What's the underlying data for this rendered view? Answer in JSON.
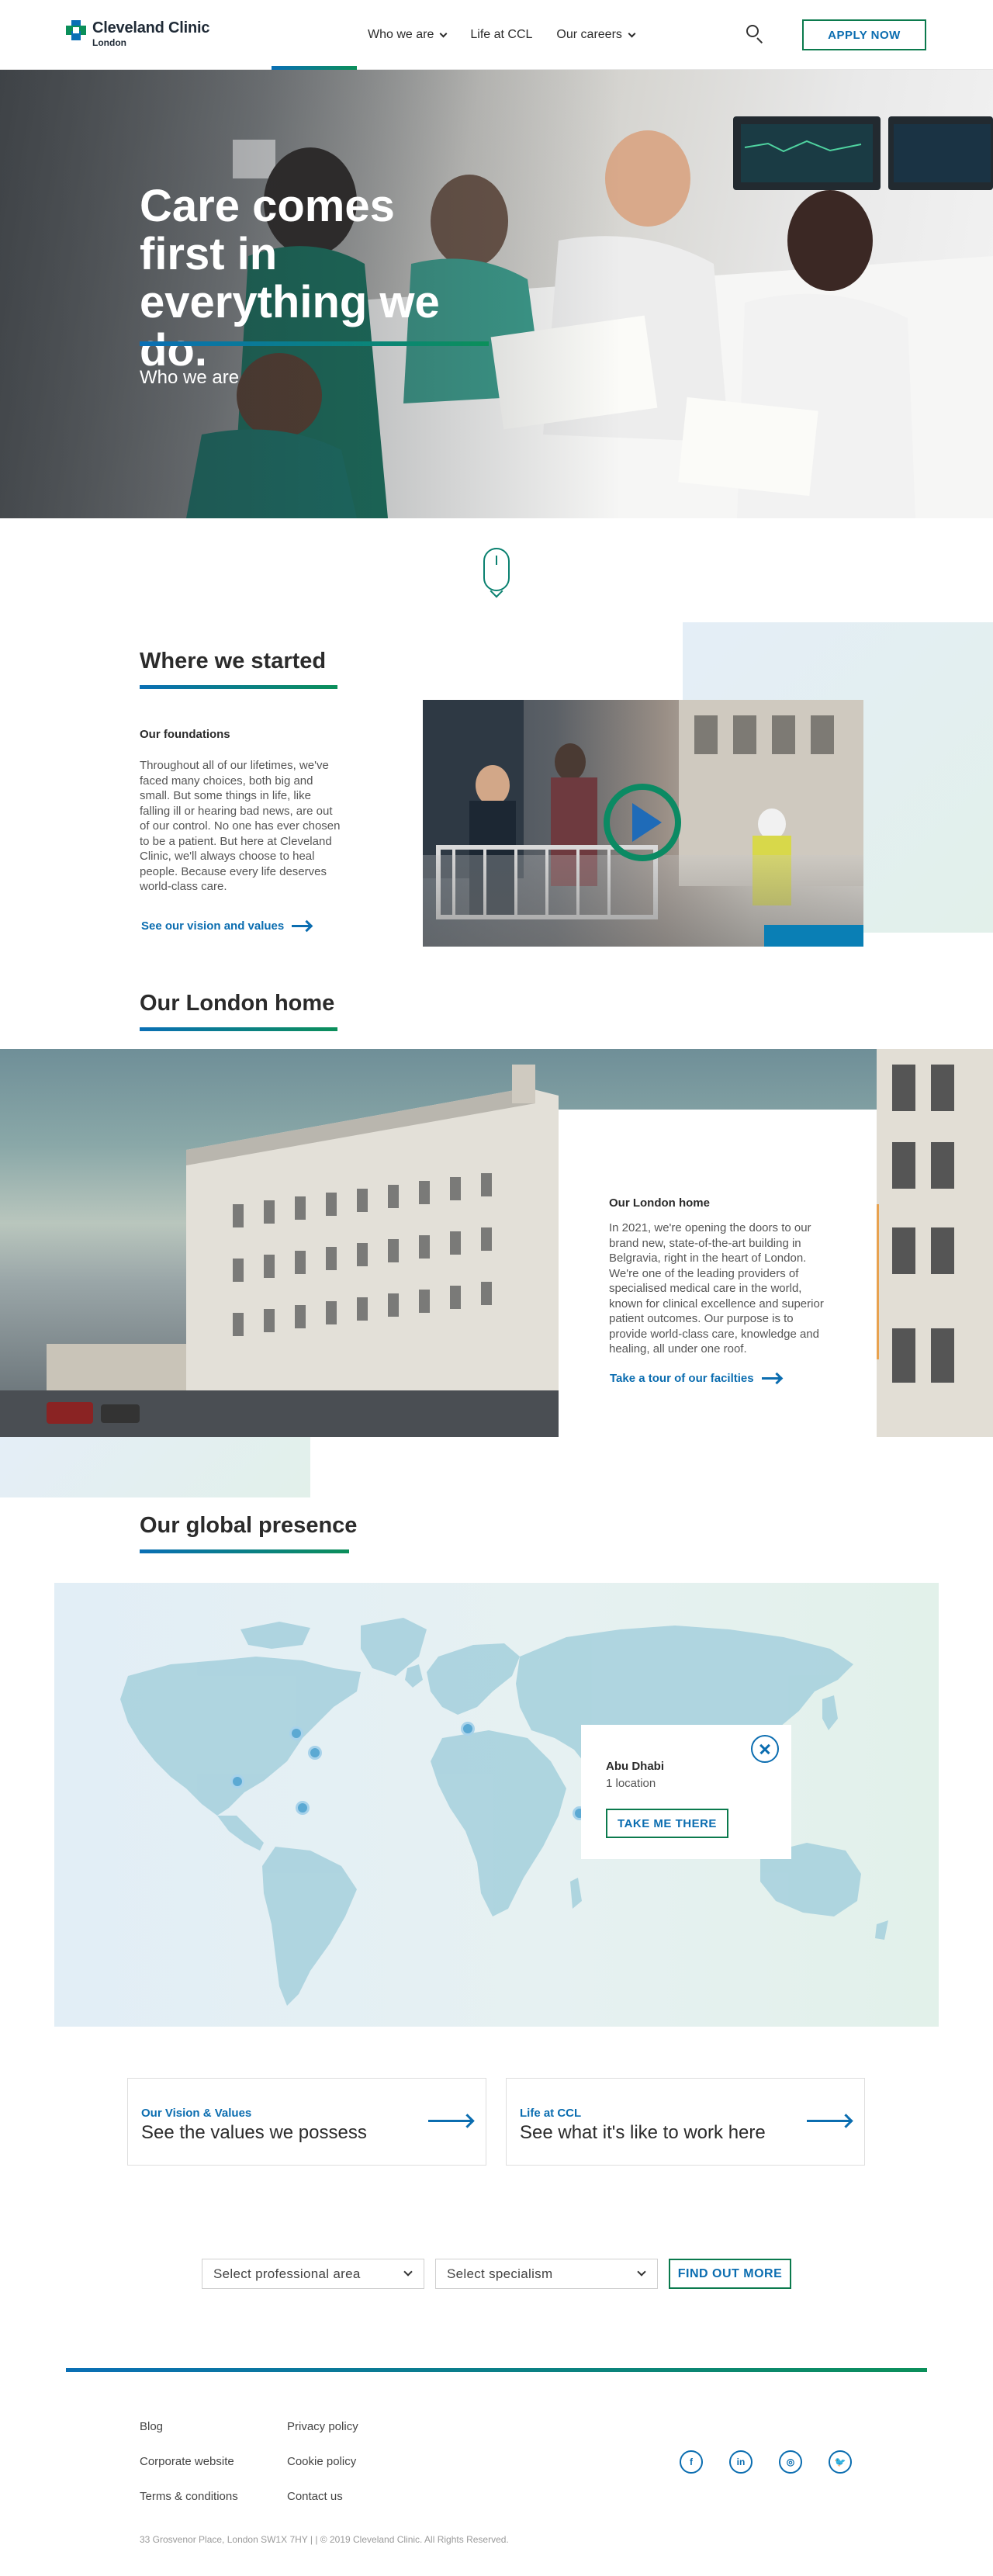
{
  "header": {
    "logo_name": "Cleveland Clinic",
    "logo_sub": "London",
    "nav": [
      {
        "label": "Who we are",
        "dropdown": true
      },
      {
        "label": "Life at CCL",
        "dropdown": false
      },
      {
        "label": "Our careers",
        "dropdown": true
      }
    ],
    "apply_label": "APPLY NOW"
  },
  "hero": {
    "title": "Care comes first in everything we do.",
    "subtitle": "Who we are"
  },
  "started": {
    "title": "Where we started",
    "heading": "Our foundations",
    "text": "Throughout all of our lifetimes, we've faced many choices, both big and small. But some things in life, like falling ill or hearing bad news, are out of our control. No one has ever chosen to be a patient. But here at Cleveland Clinic, we'll always choose to heal people. Because every life deserves world-class care.",
    "link": "See our vision and values"
  },
  "london": {
    "title": "Our London home",
    "heading": "Our London home",
    "text": "In 2021, we're opening the doors to our brand new, state-of-the-art building in Belgravia, right in the heart of London. We're one of the leading providers of specialised medical care in the world, known for clinical excellence and superior patient outcomes. Our purpose is to provide world-class care, knowledge and healing, all under one roof.",
    "link": "Take a tour of our facilties"
  },
  "global": {
    "title": "Our global presence",
    "popup": {
      "name": "Abu Dhabi",
      "count": "1 location",
      "button": "TAKE ME THERE"
    }
  },
  "promos": [
    {
      "label": "Our Vision & Values",
      "title": "See the values we possess"
    },
    {
      "label": "Life at CCL",
      "title": "See what it's like to work here"
    }
  ],
  "search": {
    "area_placeholder": "Select professional area",
    "specialism_placeholder": "Select specialism",
    "button": "FIND OUT MORE"
  },
  "footer": {
    "col1": [
      "Blog",
      "Corporate website",
      "Terms & conditions"
    ],
    "col2": [
      "Privacy policy",
      "Cookie policy",
      "Contact us"
    ],
    "social": [
      "f",
      "in",
      "◎",
      "🐦"
    ],
    "copyright": "33 Grosvenor Place, London SW1X 7HY | | © 2019 Cleveland Clinic. All Rights Reserved."
  },
  "colors": {
    "blue": "#0b6db0",
    "green": "#0b8f5a",
    "text": "#2b2b2b"
  }
}
